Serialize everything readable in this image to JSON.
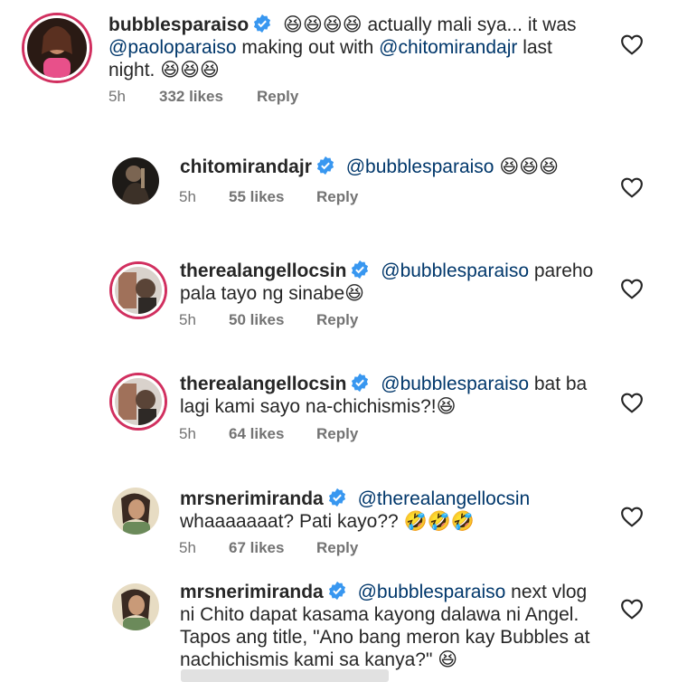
{
  "comments": [
    {
      "username": "bubblesparaiso",
      "text_parts": [
        {
          "t": "emoji",
          "v": "😆😆😆😆"
        },
        {
          "t": "text",
          "v": " actually mali sya... it was "
        },
        {
          "t": "mention",
          "v": "@paoloparaiso"
        },
        {
          "t": "text",
          "v": " making out with "
        },
        {
          "t": "mention",
          "v": "@chitomirandajr"
        },
        {
          "t": "text",
          "v": " last night. "
        },
        {
          "t": "emoji",
          "v": "😆😆😆"
        }
      ],
      "time": "5h",
      "likes": "332 likes",
      "reply": "Reply"
    },
    {
      "username": "chitomirandajr",
      "text_parts": [
        {
          "t": "mention",
          "v": "@bubblesparaiso"
        },
        {
          "t": "text",
          "v": " "
        },
        {
          "t": "emoji",
          "v": "😆😆😆"
        }
      ],
      "time": "5h",
      "likes": "55 likes",
      "reply": "Reply"
    },
    {
      "username": "therealangellocsin",
      "text_parts": [
        {
          "t": "mention",
          "v": "@bubblesparaiso"
        },
        {
          "t": "text",
          "v": " pareho pala tayo ng sinabe"
        },
        {
          "t": "emoji",
          "v": "😆"
        }
      ],
      "time": "5h",
      "likes": "50 likes",
      "reply": "Reply"
    },
    {
      "username": "therealangellocsin",
      "text_parts": [
        {
          "t": "mention",
          "v": "@bubblesparaiso"
        },
        {
          "t": "text",
          "v": " bat ba lagi kami sayo na-chichismis?!"
        },
        {
          "t": "emoji",
          "v": "😆"
        }
      ],
      "time": "5h",
      "likes": "64 likes",
      "reply": "Reply"
    },
    {
      "username": "mrsnerimiranda",
      "text_parts": [
        {
          "t": "mention",
          "v": "@therealangellocsin"
        },
        {
          "t": "text",
          "v": " whaaaaaaat? Pati kayo?? "
        },
        {
          "t": "emoji",
          "v": "🤣🤣🤣"
        }
      ],
      "time": "5h",
      "likes": "67 likes",
      "reply": "Reply"
    },
    {
      "username": "mrsnerimiranda",
      "text_parts": [
        {
          "t": "mention",
          "v": "@bubblesparaiso"
        },
        {
          "t": "text",
          "v": " next vlog ni Chito dapat kasama kayong dalawa ni Angel. Tapos ang title, \"Ano bang meron kay Bubbles at nachichismis kami sa kanya?\" "
        },
        {
          "t": "emoji",
          "v": "😆"
        }
      ]
    }
  ],
  "colors": {
    "text": "#262626",
    "mention": "#00376b",
    "meta": "#737373",
    "verified": "#3897f0",
    "story_ring": "#d12f5f"
  },
  "icons": {
    "verified": "verified-badge-icon",
    "heart": "heart-outline-icon"
  }
}
